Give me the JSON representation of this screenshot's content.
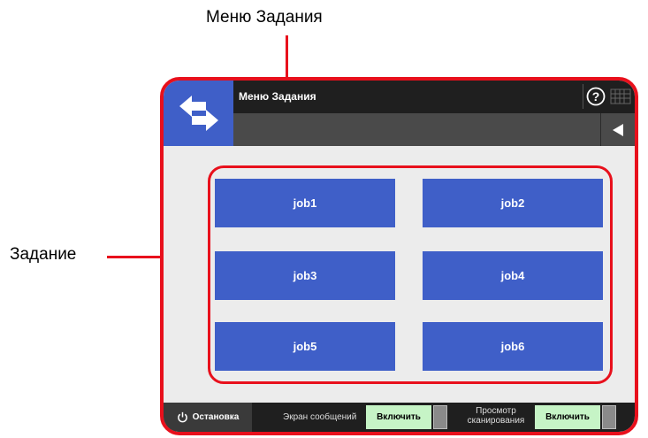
{
  "callouts": {
    "menu_label": "Меню Задания",
    "job_label": "Задание"
  },
  "header": {
    "title": "Меню Задания",
    "help_icon": "question-circle-icon",
    "keyboard_icon": "keyboard-icon",
    "back_icon": "triangle-left-icon"
  },
  "jobs": [
    "job1",
    "job2",
    "job3",
    "job4",
    "job5",
    "job6"
  ],
  "footer": {
    "stop_label": "Остановка",
    "message_screen_label": "Экран сообщений",
    "message_screen_value": "Включить",
    "scan_preview_label_line1": "Просмотр",
    "scan_preview_label_line2": "сканирования",
    "scan_preview_value": "Включить"
  },
  "colors": {
    "accent": "#3f5fc8",
    "callout_red": "#e8101c",
    "toggle_on": "#c6f4c6"
  }
}
